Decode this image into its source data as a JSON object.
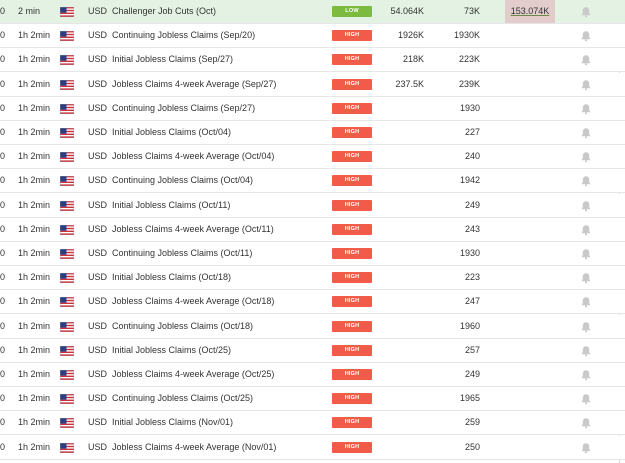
{
  "colors": {
    "high_impact": "#f25a4a",
    "low_impact": "#7cbb3f",
    "highlight_row": "#e3f2e3",
    "revised_previous_bg": "#e2cccc"
  },
  "icons": {
    "flag": "us-flag-icon",
    "bell": "bell-icon"
  },
  "rows": [
    {
      "left": "0",
      "time": "2 min",
      "currency": "USD",
      "event": "Challenger Job Cuts (Oct)",
      "impact": "LOW",
      "actual": "54.064K",
      "forecast": "73K",
      "previous": "153.074K",
      "highlight": true,
      "revised": true
    },
    {
      "left": "0",
      "time": "1h 2min",
      "currency": "USD",
      "event": "Continuing Jobless Claims (Sep/20)",
      "impact": "HIGH",
      "actual": "1926K",
      "forecast": "1930K",
      "previous": ""
    },
    {
      "left": "0",
      "time": "1h 2min",
      "currency": "USD",
      "event": "Initial Jobless Claims (Sep/27)",
      "impact": "HIGH",
      "actual": "218K",
      "forecast": "223K",
      "previous": ""
    },
    {
      "left": "0",
      "time": "1h 2min",
      "currency": "USD",
      "event": "Jobless Claims 4-week Average (Sep/27)",
      "impact": "HIGH",
      "actual": "237.5K",
      "forecast": "239K",
      "previous": ""
    },
    {
      "left": "0",
      "time": "1h 2min",
      "currency": "USD",
      "event": "Continuing Jobless Claims (Sep/27)",
      "impact": "HIGH",
      "actual": "",
      "forecast": "1930",
      "previous": ""
    },
    {
      "left": "0",
      "time": "1h 2min",
      "currency": "USD",
      "event": "Initial Jobless Claims (Oct/04)",
      "impact": "HIGH",
      "actual": "",
      "forecast": "227",
      "previous": ""
    },
    {
      "left": "0",
      "time": "1h 2min",
      "currency": "USD",
      "event": "Jobless Claims 4-week Average (Oct/04)",
      "impact": "HIGH",
      "actual": "",
      "forecast": "240",
      "previous": ""
    },
    {
      "left": "0",
      "time": "1h 2min",
      "currency": "USD",
      "event": "Continuing Jobless Claims (Oct/04)",
      "impact": "HIGH",
      "actual": "",
      "forecast": "1942",
      "previous": ""
    },
    {
      "left": "0",
      "time": "1h 2min",
      "currency": "USD",
      "event": "Initial Jobless Claims (Oct/11)",
      "impact": "HIGH",
      "actual": "",
      "forecast": "249",
      "previous": ""
    },
    {
      "left": "0",
      "time": "1h 2min",
      "currency": "USD",
      "event": "Jobless Claims 4-week Average (Oct/11)",
      "impact": "HIGH",
      "actual": "",
      "forecast": "243",
      "previous": ""
    },
    {
      "left": "0",
      "time": "1h 2min",
      "currency": "USD",
      "event": "Continuing Jobless Claims (Oct/11)",
      "impact": "HIGH",
      "actual": "",
      "forecast": "1930",
      "previous": ""
    },
    {
      "left": "0",
      "time": "1h 2min",
      "currency": "USD",
      "event": "Initial Jobless Claims (Oct/18)",
      "impact": "HIGH",
      "actual": "",
      "forecast": "223",
      "previous": ""
    },
    {
      "left": "0",
      "time": "1h 2min",
      "currency": "USD",
      "event": "Jobless Claims 4-week Average (Oct/18)",
      "impact": "HIGH",
      "actual": "",
      "forecast": "247",
      "previous": ""
    },
    {
      "left": "0",
      "time": "1h 2min",
      "currency": "USD",
      "event": "Continuing Jobless Claims (Oct/18)",
      "impact": "HIGH",
      "actual": "",
      "forecast": "1960",
      "previous": ""
    },
    {
      "left": "0",
      "time": "1h 2min",
      "currency": "USD",
      "event": "Initial Jobless Claims (Oct/25)",
      "impact": "HIGH",
      "actual": "",
      "forecast": "257",
      "previous": ""
    },
    {
      "left": "0",
      "time": "1h 2min",
      "currency": "USD",
      "event": "Jobless Claims 4-week Average (Oct/25)",
      "impact": "HIGH",
      "actual": "",
      "forecast": "249",
      "previous": ""
    },
    {
      "left": "0",
      "time": "1h 2min",
      "currency": "USD",
      "event": "Continuing Jobless Claims (Oct/25)",
      "impact": "HIGH",
      "actual": "",
      "forecast": "1965",
      "previous": ""
    },
    {
      "left": "0",
      "time": "1h 2min",
      "currency": "USD",
      "event": "Initial Jobless Claims (Nov/01)",
      "impact": "HIGH",
      "actual": "",
      "forecast": "259",
      "previous": ""
    },
    {
      "left": "0",
      "time": "1h 2min",
      "currency": "USD",
      "event": "Jobless Claims 4-week Average (Nov/01)",
      "impact": "HIGH",
      "actual": "",
      "forecast": "250",
      "previous": ""
    }
  ]
}
